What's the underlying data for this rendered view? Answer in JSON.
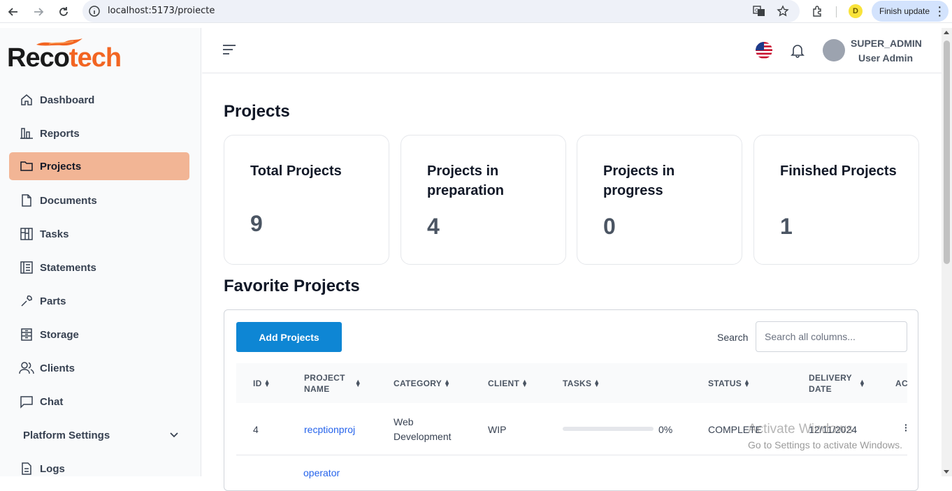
{
  "browser": {
    "url": "localhost:5173/proiecte",
    "profile_initial": "D",
    "finish_update": "Finish update"
  },
  "brand": {
    "logo_part1": "Reco",
    "logo_part2": "tech"
  },
  "sidebar": {
    "items": [
      {
        "label": "Dashboard",
        "icon": "home-icon"
      },
      {
        "label": "Reports",
        "icon": "bar-chart-icon"
      },
      {
        "label": "Projects",
        "icon": "folder-icon",
        "active": true
      },
      {
        "label": "Documents",
        "icon": "file-icon"
      },
      {
        "label": "Tasks",
        "icon": "kanban-icon"
      },
      {
        "label": "Statements",
        "icon": "list-icon"
      },
      {
        "label": "Parts",
        "icon": "wrench-icon"
      },
      {
        "label": "Storage",
        "icon": "cabinet-icon"
      },
      {
        "label": "Clients",
        "icon": "users-icon"
      },
      {
        "label": "Chat",
        "icon": "chat-icon"
      },
      {
        "label": "Platform Settings",
        "icon": "chevron-down-icon"
      },
      {
        "label": "Logs",
        "icon": "log-icon"
      }
    ]
  },
  "header": {
    "role": "SUPER_ADMIN",
    "user": "User Admin"
  },
  "main": {
    "title": "Projects",
    "stats": [
      {
        "label": "Total Projects",
        "value": "9"
      },
      {
        "label": "Projects in preparation",
        "value": "4"
      },
      {
        "label": "Projects in progress",
        "value": "0"
      },
      {
        "label": "Finished Projects",
        "value": "1"
      }
    ],
    "favorites_title": "Favorite Projects",
    "add_button": "Add Projects",
    "search_label": "Search",
    "search_placeholder": "Search all columns...",
    "columns": {
      "id": "ID",
      "name_1": "PROJECT",
      "name_2": "NAME",
      "category": "CATEGORY",
      "client": "CLIENT",
      "tasks": "TASKS",
      "status": "STATUS",
      "delivery_1": "DELIVERY",
      "delivery_2": "DATE",
      "actions": "AC"
    },
    "rows": [
      {
        "id": "4",
        "name": "recptionproj",
        "category_1": "Web",
        "category_2": "Development",
        "client": "WIP",
        "progress": 0,
        "progress_label": "0%",
        "status": "COMPLETE",
        "delivery": "12/11/2024"
      }
    ],
    "partial_row_name": "operator"
  },
  "overlay": {
    "line1": "Activate Windows",
    "line2": "Go to Settings to activate Windows."
  },
  "colors": {
    "accent": "#f26522",
    "active_nav": "#f2b595",
    "primary_button": "#0e86d4",
    "link": "#2563eb"
  }
}
